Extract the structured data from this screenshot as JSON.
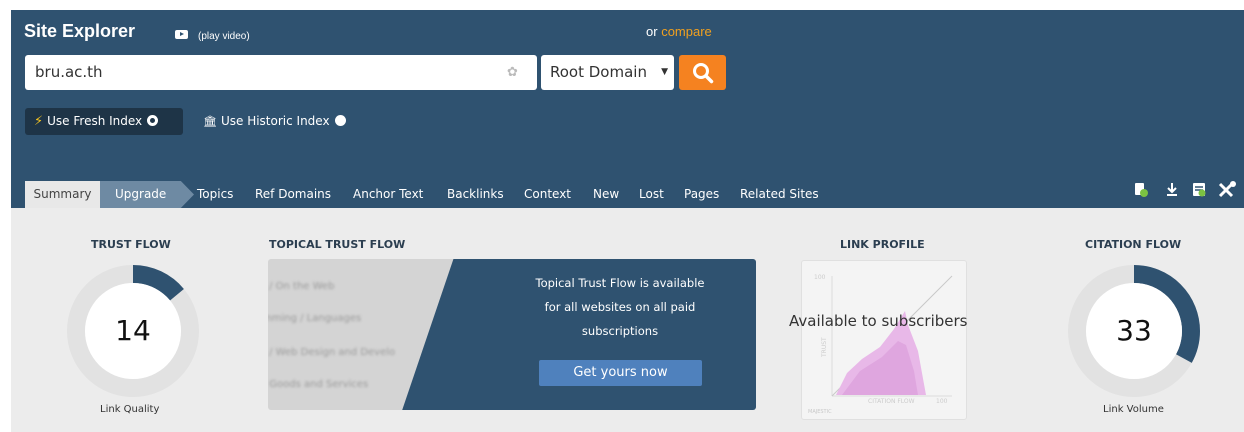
{
  "header": {
    "title": "Site Explorer",
    "play_video": "(play video)",
    "compare_prefix": "or",
    "compare_link": "compare"
  },
  "search": {
    "value": "bru.ac.th",
    "scope": "Root Domain"
  },
  "index": {
    "fresh_label": "Use Fresh Index",
    "historic_label": "Use Historic Index",
    "selected": "fresh"
  },
  "tabs": [
    {
      "label": "Summary"
    },
    {
      "label": "Upgrade"
    },
    {
      "label": "Topics"
    },
    {
      "label": "Ref Domains"
    },
    {
      "label": "Anchor Text"
    },
    {
      "label": "Backlinks"
    },
    {
      "label": "Context"
    },
    {
      "label": "New"
    },
    {
      "label": "Lost"
    },
    {
      "label": "Pages"
    },
    {
      "label": "Related Sites"
    }
  ],
  "toolbar": {
    "icons": [
      "report-icon",
      "download-icon",
      "export-icon",
      "tools-icon"
    ]
  },
  "trust_flow": {
    "title": "TRUST FLOW",
    "value": "14",
    "caption": "Link Quality",
    "fraction": 0.14
  },
  "topical_trust_flow": {
    "title": "TOPICAL TRUST FLOW",
    "blurred_items": [
      "t / On the Web",
      "mming / Languages",
      "t / Web Design and Develo",
      "r Goods and Services"
    ],
    "message_lines": [
      "Topical Trust Flow is available",
      "for all websites on all paid",
      "subscriptions"
    ],
    "button": "Get yours now"
  },
  "link_profile": {
    "title": "LINK PROFILE",
    "overlay": "Available to subscribers",
    "axis_top": "100",
    "axis_right": "100",
    "x_label": "CITATION FLOW",
    "y_label": "TRUST",
    "logo": "MAJESTIC"
  },
  "citation_flow": {
    "title": "CITATION FLOW",
    "value": "33",
    "caption": "Link Volume",
    "fraction": 0.33
  },
  "colors": {
    "header_bg": "#2f5270",
    "accent_orange": "#f58220",
    "compare_link": "#f0a020",
    "gauge_arc": "#2f5270",
    "gauge_track": "#e2e2e2"
  }
}
